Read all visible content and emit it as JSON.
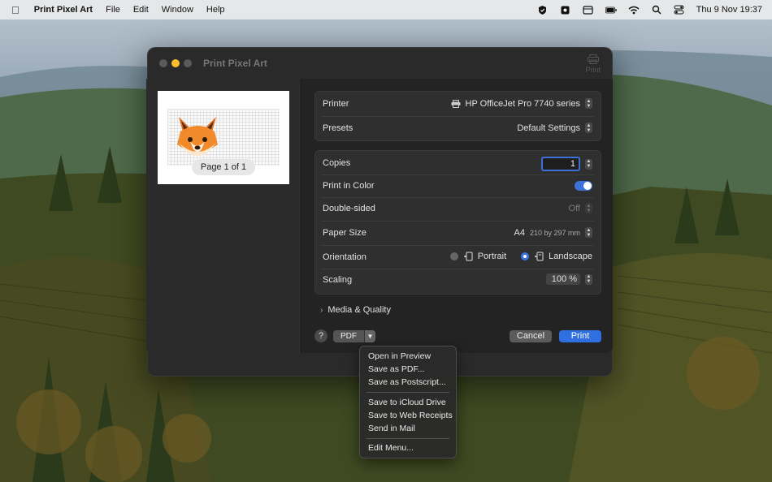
{
  "menubar": {
    "app_name": "Print Pixel Art",
    "items": [
      "File",
      "Edit",
      "Window",
      "Help"
    ],
    "clock": "Thu 9 Nov  19:37"
  },
  "window": {
    "title": "Print Pixel Art",
    "toolbar_print_label": "Print"
  },
  "preview": {
    "page_label": "Page 1 of 1"
  },
  "printer_group": {
    "printer_label": "Printer",
    "printer_value": "HP OfficeJet Pro 7740 series",
    "presets_label": "Presets",
    "presets_value": "Default Settings"
  },
  "settings": {
    "copies_label": "Copies",
    "copies_value": "1",
    "color_label": "Print in Color",
    "color_on": true,
    "duplex_label": "Double-sided",
    "duplex_value": "Off",
    "paper_label": "Paper Size",
    "paper_value": "A4",
    "paper_dims": "210 by 297 mm",
    "orientation_label": "Orientation",
    "orientation_portrait": "Portrait",
    "orientation_landscape": "Landscape",
    "orientation_selected": "Landscape",
    "scaling_label": "Scaling",
    "scaling_value": "100 %"
  },
  "media_quality_label": "Media & Quality",
  "bottom": {
    "help_label": "?",
    "pdf_label": "PDF",
    "cancel_label": "Cancel",
    "print_label": "Print"
  },
  "pdf_menu": {
    "group1": [
      "Open in Preview",
      "Save as PDF...",
      "Save as Postscript..."
    ],
    "group2": [
      "Save to iCloud Drive",
      "Save to Web Receipts",
      "Send in Mail"
    ],
    "group3": [
      "Edit Menu..."
    ]
  },
  "colors": {
    "accent": "#2f6fe0",
    "window_bg": "#2a2a2a",
    "group_bg": "#2f2f2f"
  }
}
